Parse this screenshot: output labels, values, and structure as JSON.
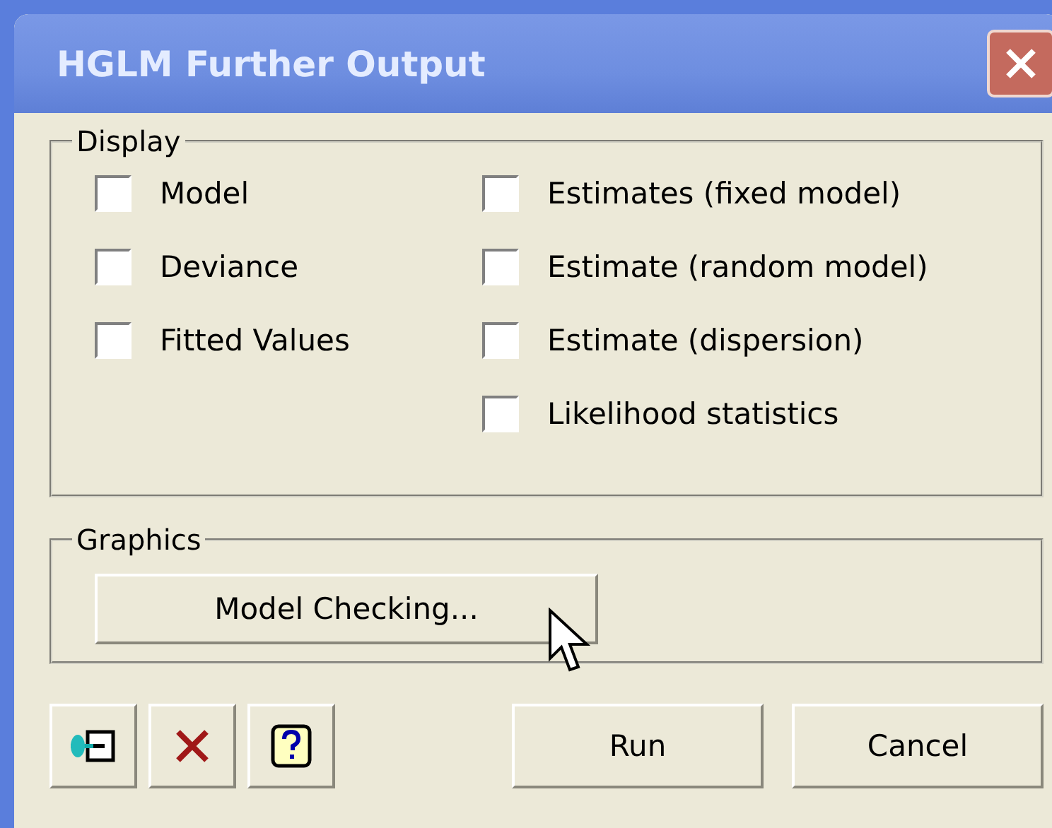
{
  "window": {
    "title": "HGLM Further Output"
  },
  "display": {
    "label": "Display",
    "left": [
      {
        "label": "Model",
        "checked": false
      },
      {
        "label": "Deviance",
        "checked": false
      },
      {
        "label": "Fitted Values",
        "checked": false
      }
    ],
    "right": [
      {
        "label": "Estimates (fixed model)",
        "checked": false
      },
      {
        "label": "Estimate (random model)",
        "checked": false
      },
      {
        "label": "Estimate (dispersion)",
        "checked": false
      },
      {
        "label": "Likelihood statistics",
        "checked": false
      }
    ]
  },
  "graphics": {
    "label": "Graphics",
    "button": "Model Checking..."
  },
  "buttons": [
    "Run",
    "Cancel"
  ]
}
